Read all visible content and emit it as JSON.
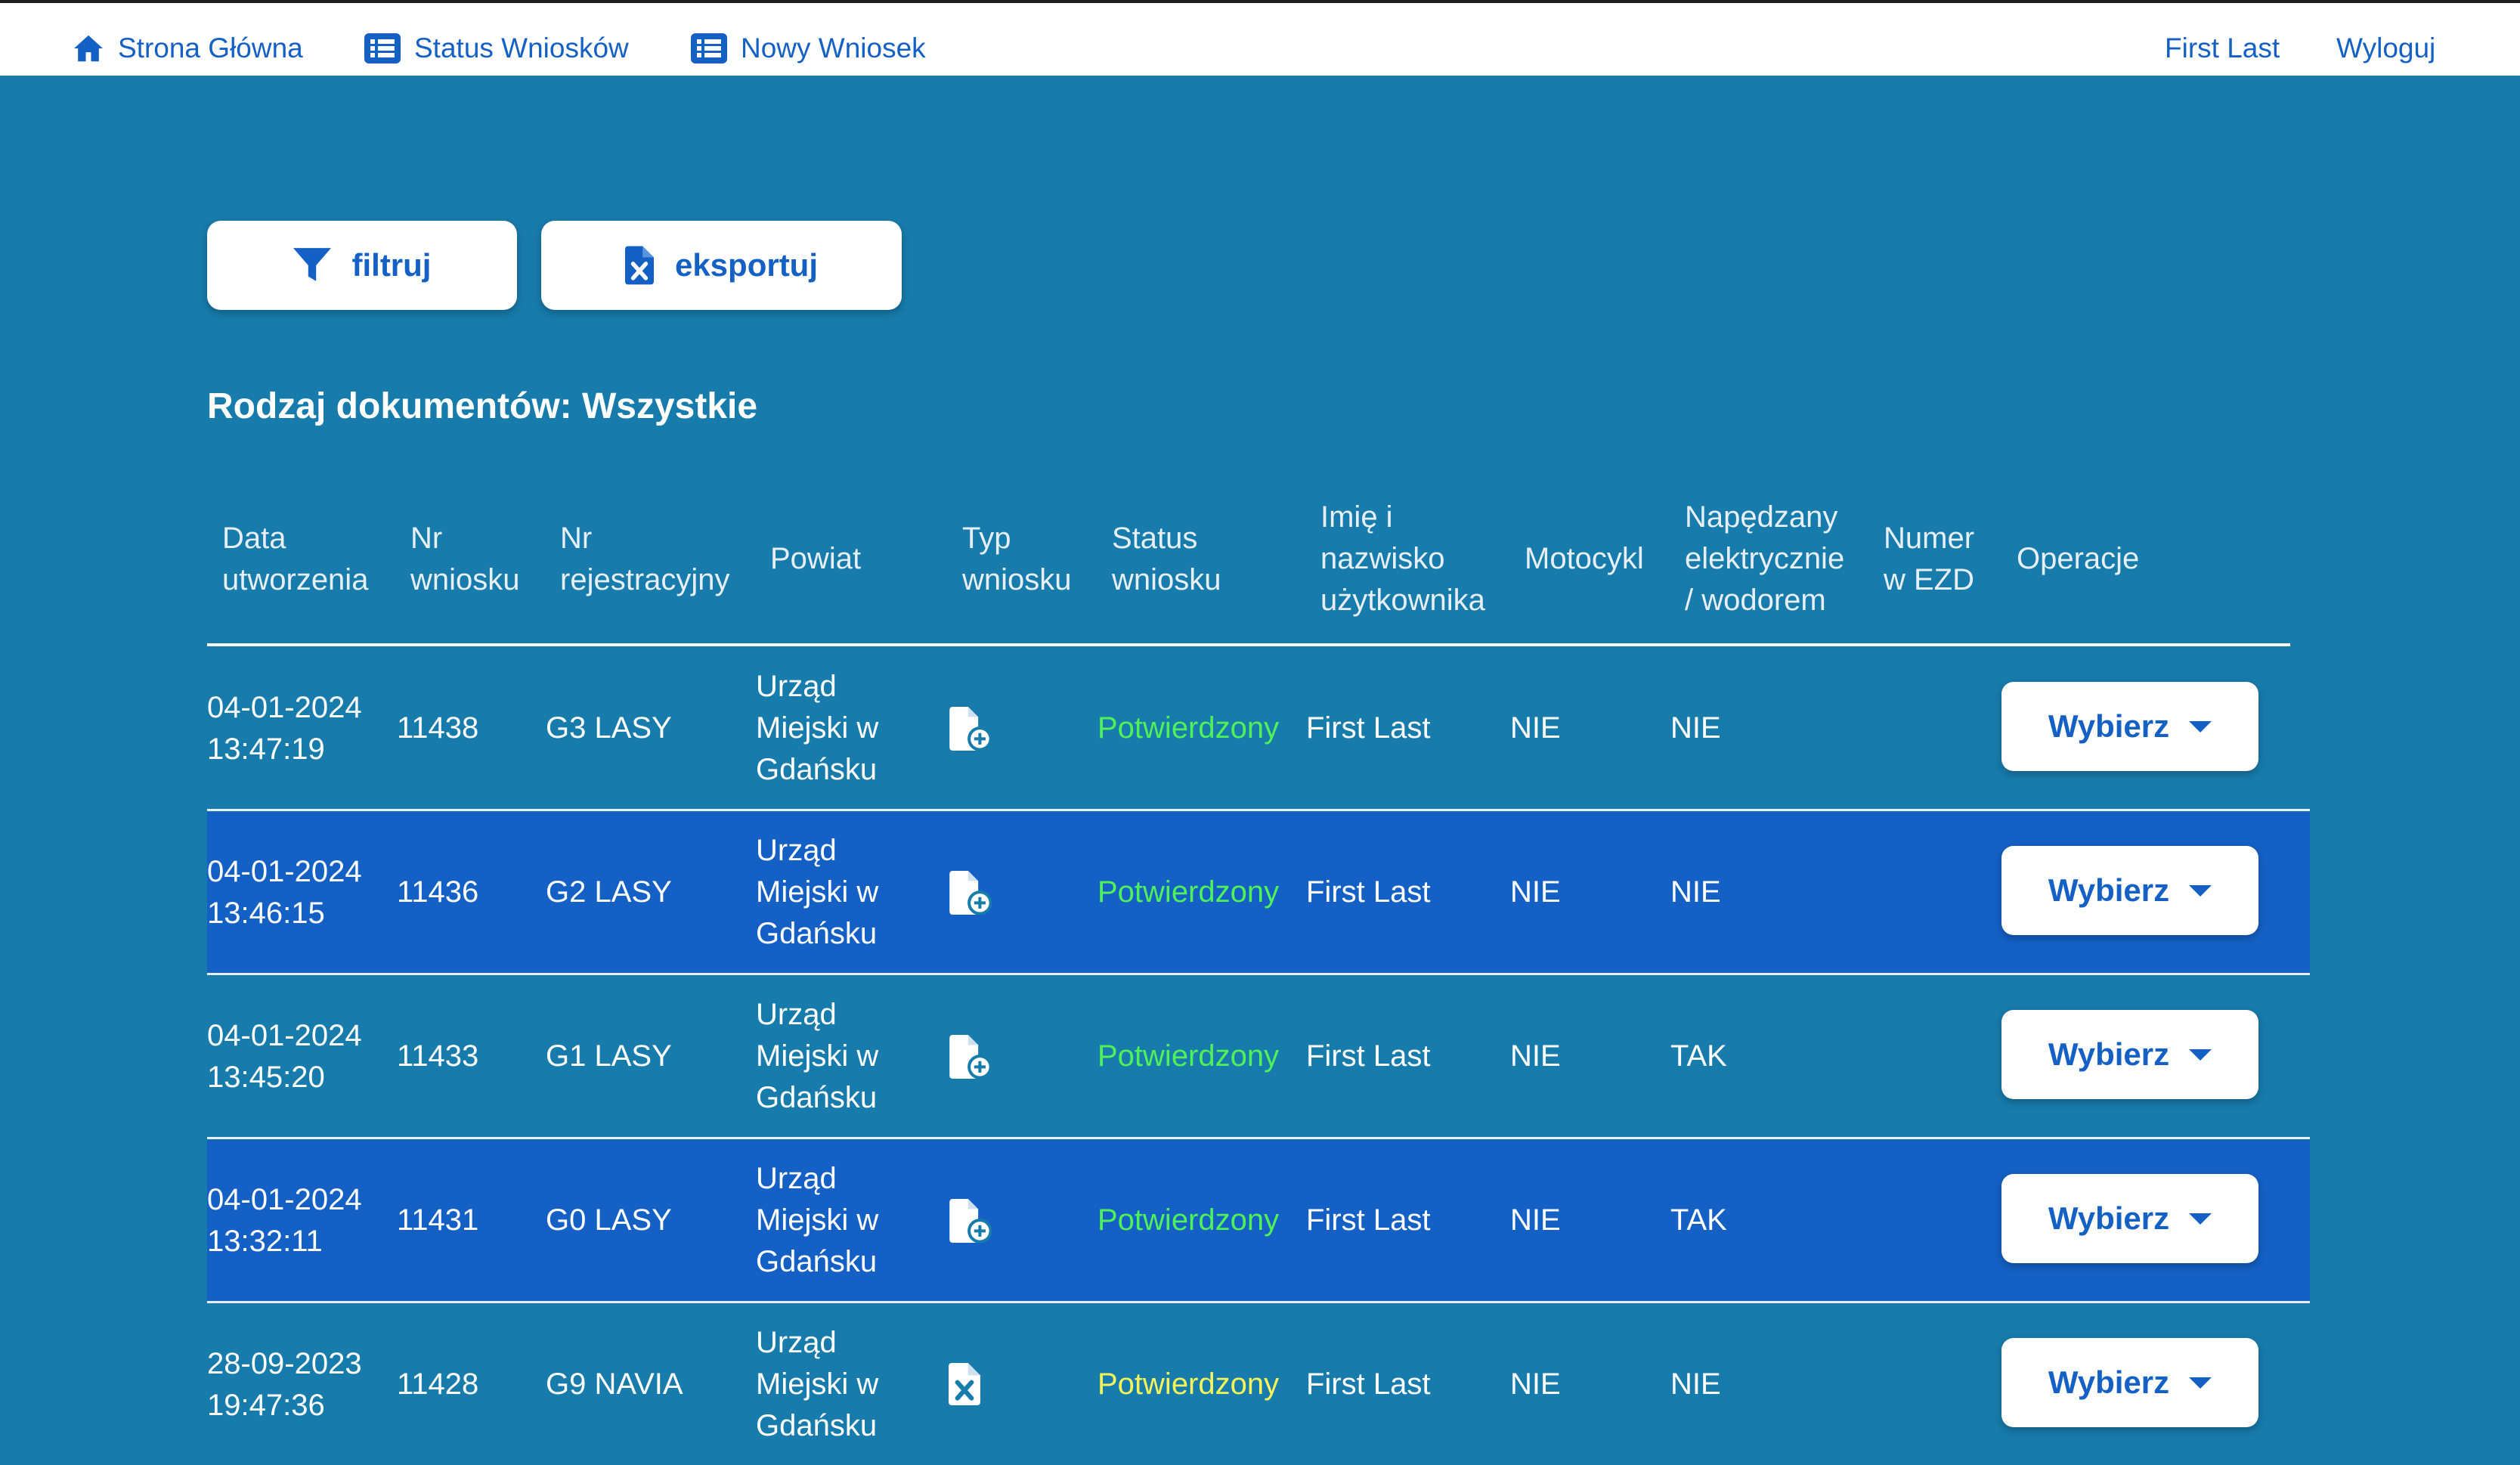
{
  "nav": {
    "home": "Strona Główna",
    "status": "Status Wniosków",
    "new": "Nowy Wniosek",
    "user": "First Last",
    "logout": "Wyloguj"
  },
  "toolbar": {
    "filter_label": "filtruj",
    "export_label": "eksportuj"
  },
  "doc_type_label": "Rodzaj dokumentów: Wszystkie",
  "table": {
    "headers": {
      "date": [
        "Data",
        "utworzenia"
      ],
      "number": [
        "Nr",
        "wniosku"
      ],
      "registration": [
        "Nr",
        "rejestracyjny"
      ],
      "district": [
        "Powiat"
      ],
      "type": [
        "Typ",
        "wniosku"
      ],
      "status": [
        "Status",
        "wniosku"
      ],
      "user": [
        "Imię i",
        "nazwisko",
        "użytkownika"
      ],
      "motorcycle": [
        "Motocykl"
      ],
      "electric": [
        "Napędzany",
        "elektrycznie",
        "/ wodorem"
      ],
      "ezd": [
        "Numer",
        "w EZD"
      ],
      "operations": [
        "Operacje"
      ]
    },
    "rows": [
      {
        "date": "04-01-2024",
        "time": "13:47:19",
        "number": "11438",
        "registration": "G3 LASY",
        "district": [
          "Urząd",
          "Miejski w",
          "Gdańsku"
        ],
        "type_icon": "file-plus-icon",
        "status": "Potwierdzony",
        "status_color": "#4ff05a",
        "user": "First Last",
        "motorcycle": "NIE",
        "electric": "NIE",
        "ezd": "",
        "action": "Wybierz"
      },
      {
        "date": "04-01-2024",
        "time": "13:46:15",
        "number": "11436",
        "registration": "G2 LASY",
        "district": [
          "Urząd",
          "Miejski w",
          "Gdańsku"
        ],
        "type_icon": "file-plus-icon",
        "status": "Potwierdzony",
        "status_color": "#4ff05a",
        "user": "First Last",
        "motorcycle": "NIE",
        "electric": "NIE",
        "ezd": "",
        "action": "Wybierz"
      },
      {
        "date": "04-01-2024",
        "time": "13:45:20",
        "number": "11433",
        "registration": "G1 LASY",
        "district": [
          "Urząd",
          "Miejski w",
          "Gdańsku"
        ],
        "type_icon": "file-plus-icon",
        "status": "Potwierdzony",
        "status_color": "#4ff05a",
        "user": "First Last",
        "motorcycle": "NIE",
        "electric": "TAK",
        "ezd": "",
        "action": "Wybierz"
      },
      {
        "date": "04-01-2024",
        "time": "13:32:11",
        "number": "11431",
        "registration": "G0 LASY",
        "district": [
          "Urząd",
          "Miejski w",
          "Gdańsku"
        ],
        "type_icon": "file-plus-icon",
        "status": "Potwierdzony",
        "status_color": "#4ff05a",
        "user": "First Last",
        "motorcycle": "NIE",
        "electric": "TAK",
        "ezd": "",
        "action": "Wybierz"
      },
      {
        "date": "28-09-2023",
        "time": "19:47:36",
        "number": "11428",
        "registration": "G9 NAVIA",
        "district": [
          "Urząd",
          "Miejski w",
          "Gdańsku"
        ],
        "type_icon": "file-x-icon",
        "status": "Potwierdzony",
        "status_color": "#f4f45a",
        "user": "First Last",
        "motorcycle": "NIE",
        "electric": "NIE",
        "ezd": "",
        "action": "Wybierz"
      }
    ]
  },
  "colors": {
    "background": "#177bab",
    "alt_row": "#1460c4",
    "accent": "#1460c4"
  }
}
